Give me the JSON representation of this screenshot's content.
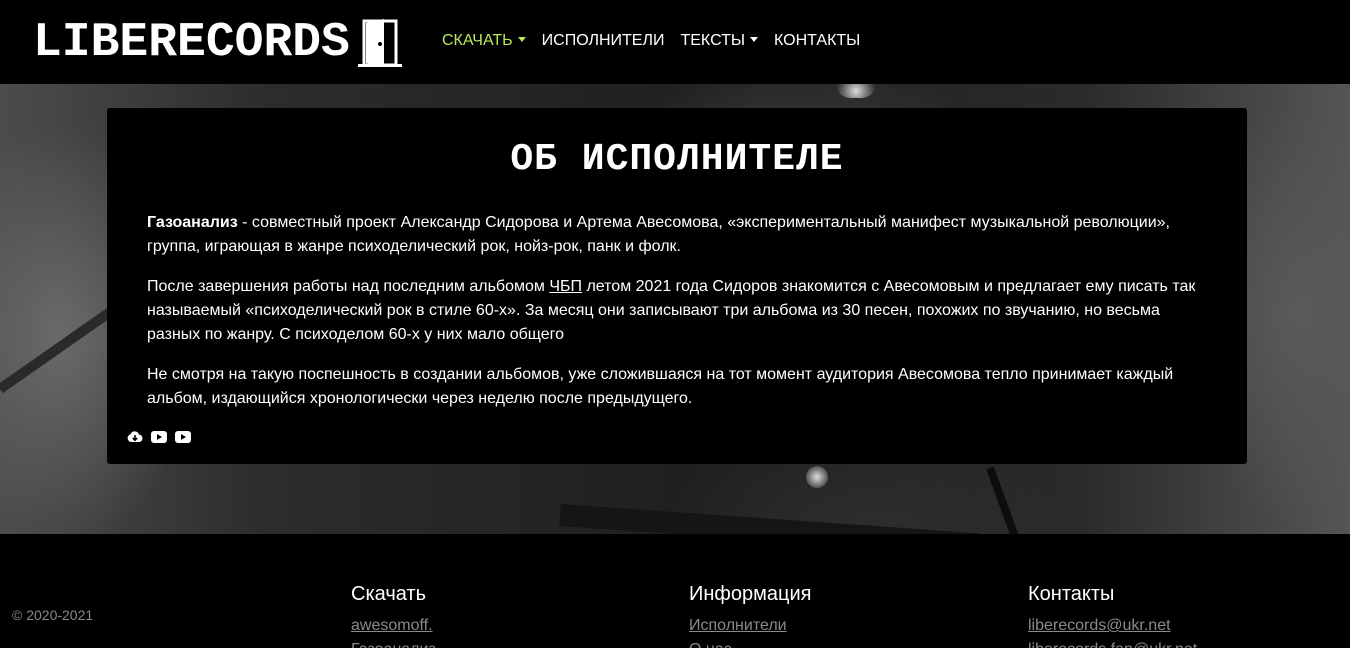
{
  "brand": {
    "name": "LIBERECORDS"
  },
  "nav": {
    "items": [
      {
        "label": "СКАЧАТЬ",
        "dropdown": true,
        "active": true
      },
      {
        "label": "ИСПОЛНИТЕЛИ",
        "dropdown": false
      },
      {
        "label": "ТЕКСТЫ",
        "dropdown": true
      },
      {
        "label": "КОНТАКТЫ",
        "dropdown": false
      }
    ],
    "active_color": "#b5e85a"
  },
  "about": {
    "title": "ОБ ИСПОЛНИТЕЛЕ",
    "p1_bold": "Газоанализ",
    "p1_rest": " - совместный проект Александр Сидорова и Артема Авесомова, «экспериментальный манифест музыкальной революции», группа, играющая в жанре психоделический рок, нойз-рок, панк и фолк.",
    "p2_before": "После завершения работы над последним альбомом ",
    "p2_link": "ЧБП",
    "p2_after": " летом 2021 года Сидоров знакомится с Авесомовым и предлагает ему писать так называемый «психоделический рок в стиле 60-х». За месяц они записывают три альбома из 30 песен, похожих по звучанию, но весьма разных по жанру. С психоделом 60-х у них мало общего",
    "p3": "Не смотря на такую поспешность в создании альбомов, уже сложившаяся на тот момент аудитория Авесомова тепло принимает каждый альбом, издающийся хронологически через неделю после предыдущего.",
    "socials": [
      "cloud-download-icon",
      "youtube-icon",
      "youtube-icon"
    ]
  },
  "footer": {
    "copyright": "© 2020-2021",
    "columns": [
      {
        "title": "Скачать",
        "links": [
          "awesomoff.",
          "Газоанализ"
        ]
      },
      {
        "title": "Информация",
        "links": [
          "Исполнители",
          "О нас"
        ]
      },
      {
        "title": "Контакты",
        "links": [
          "liberecords@ukr.net",
          "liberecords.fan@ukr.net"
        ]
      }
    ]
  }
}
